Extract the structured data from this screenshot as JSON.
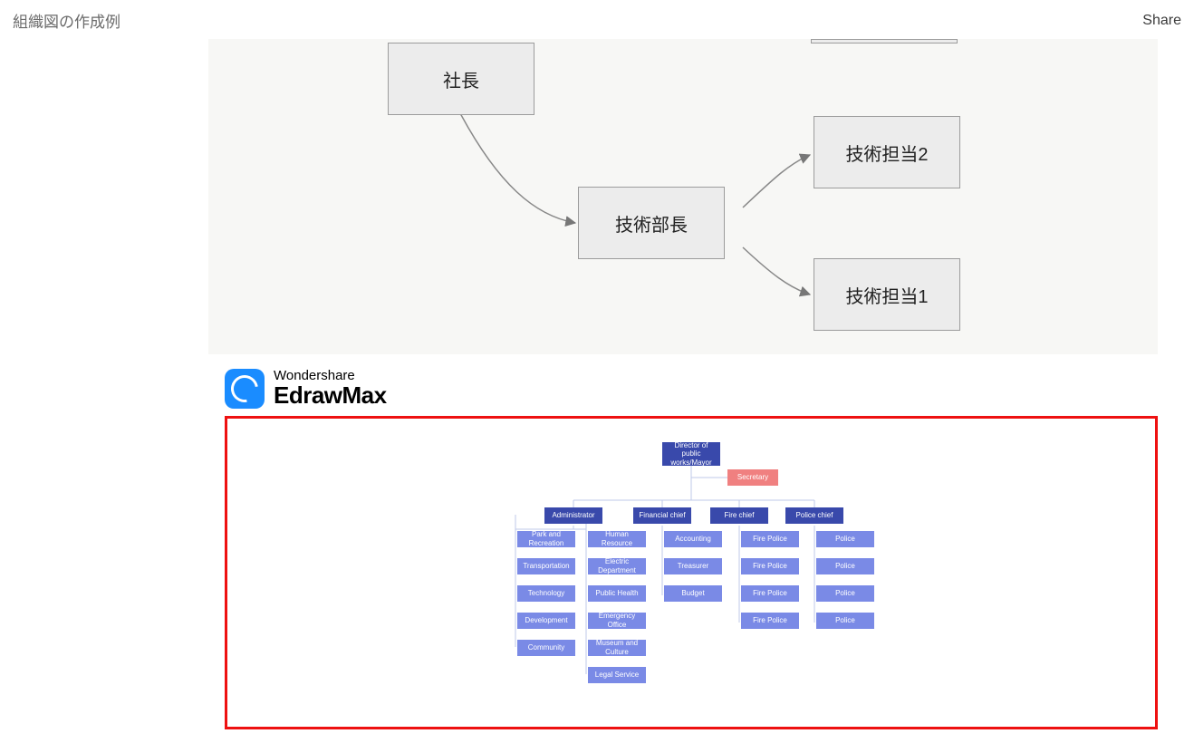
{
  "header": {
    "title": "組織図の作成例",
    "share": "Share"
  },
  "diagram1": {
    "president": "社長",
    "tech_lead": "技術部長",
    "tech_staff2": "技術担当2",
    "tech_staff1": "技術担当1"
  },
  "brand": {
    "line1": "Wondershare",
    "line2": "EdrawMax"
  },
  "diagram2": {
    "director": "Director of public works/Mayor",
    "secretary": "Secretary",
    "cols": [
      {
        "head": "Administrator",
        "items": [
          "Park and Recreation",
          "Transportation",
          "Technology",
          "Development",
          "Community"
        ]
      },
      {
        "head": "",
        "items": [
          "Human Resource",
          "Electric Department",
          "Public Health",
          "Emergency Office",
          "Museum and Culture",
          "Legal Service"
        ]
      },
      {
        "head": "Financial chief",
        "items": [
          "Accounting",
          "Treasurer",
          "Budget"
        ]
      },
      {
        "head": "Fire chief",
        "items": [
          "Fire Police",
          "Fire Police",
          "Fire Police",
          "Fire Police"
        ]
      },
      {
        "head": "Police chief",
        "items": [
          "Police",
          "Police",
          "Police",
          "Police"
        ]
      }
    ]
  }
}
